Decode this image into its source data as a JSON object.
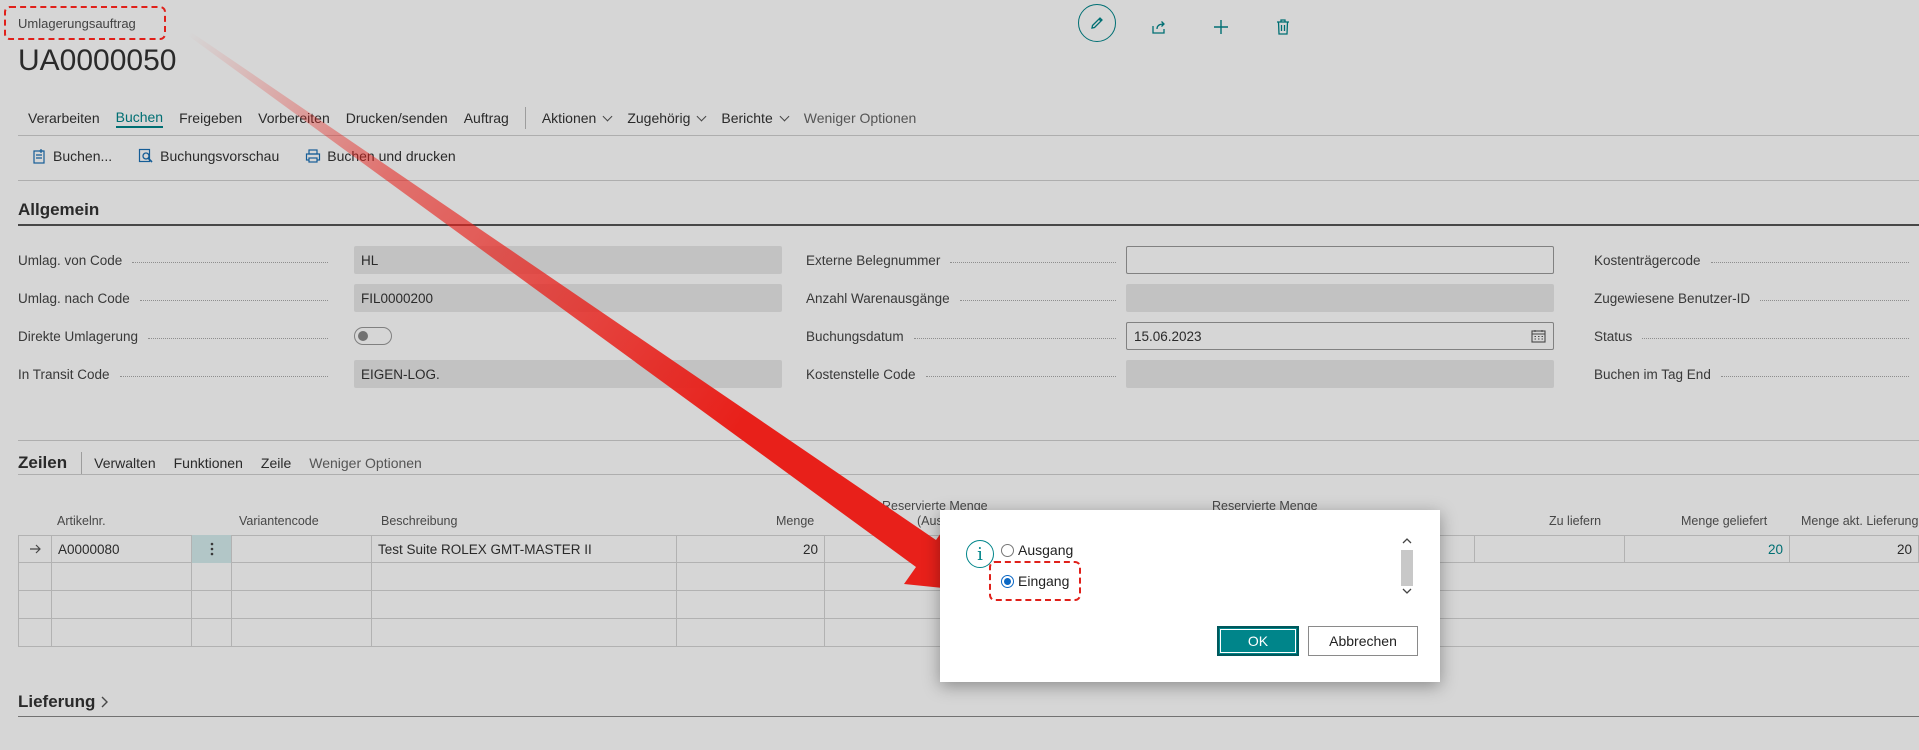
{
  "header": {
    "caption": "Umlagerungsauftrag",
    "doc_number": "UA0000050",
    "icons": [
      "pencil-icon",
      "share-icon",
      "plus-icon",
      "trash-icon"
    ]
  },
  "menu": {
    "items": [
      {
        "label": "Verarbeiten"
      },
      {
        "label": "Buchen",
        "active": true
      },
      {
        "label": "Freigeben"
      },
      {
        "label": "Vorbereiten"
      },
      {
        "label": "Drucken/senden"
      },
      {
        "label": "Auftrag"
      },
      {
        "label": "Aktionen"
      },
      {
        "label": "Zugehörig"
      },
      {
        "label": "Berichte"
      },
      {
        "label": "Weniger Optionen"
      }
    ]
  },
  "actions": {
    "post": "Buchen...",
    "preview": "Buchungsvorschau",
    "post_print": "Buchen und drucken"
  },
  "general": {
    "title": "Allgemein",
    "fields": [
      {
        "label": "Umlag. von Code",
        "value": "HL"
      },
      {
        "label": "Umlag. nach Code",
        "value": "FIL0000200"
      },
      {
        "label": "Direkte Umlagerung",
        "value": ""
      },
      {
        "label": "In Transit Code",
        "value": "EIGEN-LOG."
      },
      {
        "label": "Externe Belegnummer",
        "value": ""
      },
      {
        "label": "Anzahl Warenausgänge",
        "value": ""
      },
      {
        "label": "Buchungsdatum",
        "value": "15.06.2023"
      },
      {
        "label": "Kostenstelle Code",
        "value": ""
      },
      {
        "label": "Kostenträgercode"
      },
      {
        "label": "Zugewiesene Benutzer-ID"
      },
      {
        "label": "Status"
      },
      {
        "label": "Buchen im Tag End"
      }
    ]
  },
  "lines": {
    "title": "Zeilen",
    "menu": [
      "Verwalten",
      "Funktionen",
      "Zeile",
      "Weniger Optionen"
    ],
    "columns": {
      "item_no": "Artikelnr.",
      "variant": "Variantencode",
      "description": "Beschreibung",
      "qty": "Menge",
      "reserved_out_1": "Reservierte Menge",
      "reserved_out_2": "(Ausg",
      "reserved_in_1": "Reservierte Menge",
      "to_deliver": "Zu liefern",
      "qty_shipped": "Menge geliefert",
      "qty_current": "Menge akt. Lieferung"
    },
    "rows": [
      {
        "item_no": "A0000080",
        "variant": "",
        "description": "Test Suite ROLEX GMT-MASTER II",
        "qty": "20",
        "qty_shipped": "20",
        "qty_current": "20"
      }
    ]
  },
  "delivery": {
    "title": "Lieferung"
  },
  "dialog": {
    "options": [
      {
        "label": "Ausgang",
        "checked": false
      },
      {
        "label": "Eingang",
        "checked": true
      }
    ],
    "ok_label": "OK",
    "cancel_label": "Abbrechen"
  },
  "colors": {
    "accent": "#00858a",
    "annotation": "#e0201a"
  }
}
